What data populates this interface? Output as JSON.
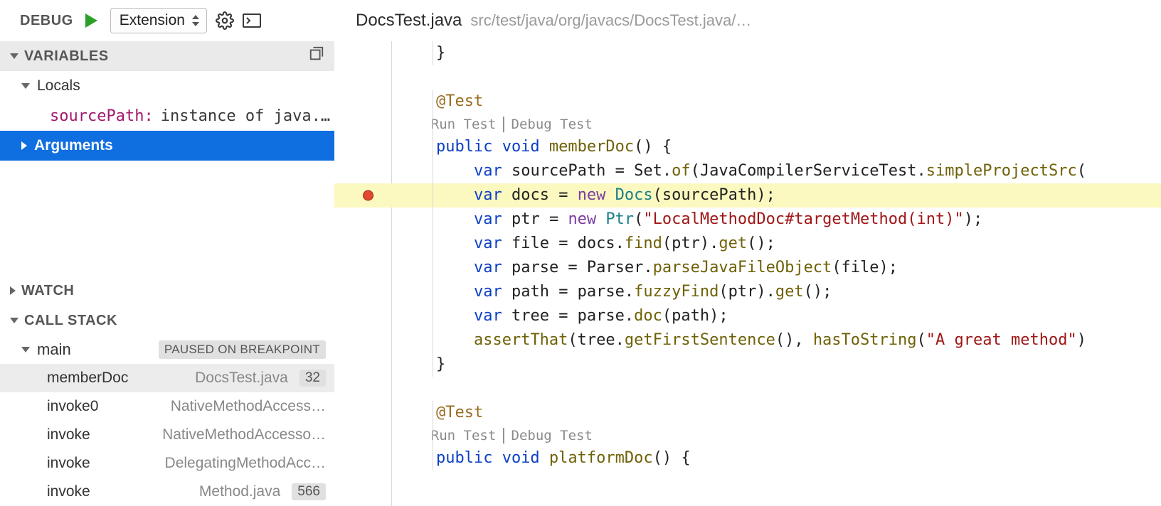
{
  "debug": {
    "label": "DEBUG",
    "config": "Extension"
  },
  "sections": {
    "variables": "VARIABLES",
    "watch": "WATCH",
    "callstack": "CALL STACK"
  },
  "variables": {
    "locals_label": "Locals",
    "sourcePath_key": "sourcePath:",
    "sourcePath_val": "instance of java.u…",
    "arguments_label": "Arguments"
  },
  "callstack": {
    "thread_name": "main",
    "thread_state": "PAUSED ON BREAKPOINT",
    "frames": [
      {
        "fn": "memberDoc",
        "file": "DocsTest.java",
        "line": "32"
      },
      {
        "fn": "invoke0",
        "file": "NativeMethodAccess…",
        "line": ""
      },
      {
        "fn": "invoke",
        "file": "NativeMethodAccesso…",
        "line": ""
      },
      {
        "fn": "invoke",
        "file": "DelegatingMethodAcc…",
        "line": ""
      },
      {
        "fn": "invoke",
        "file": "Method.java",
        "line": "566"
      }
    ]
  },
  "editor": {
    "tab_title": "DocsTest.java",
    "tab_path": "src/test/java/org/javacs/DocsTest.java/…",
    "codelens_run": "Run Test",
    "codelens_debug": "Debug Test"
  },
  "code": {
    "l0": "    }",
    "l1": "",
    "l2a": "    @Test",
    "l3a": "    Run Test | Debug Test",
    "l4_kw1": "    public",
    "l4_kw2": " void",
    "l4_fn": " memberDoc",
    "l4_rest": "() {",
    "l5_pre": "        ",
    "l5_kw": "var",
    "l5_rest1": " sourcePath = Set.",
    "l5_of": "of",
    "l5_rest2": "(JavaCompilerServiceTest.",
    "l5_sp": "simpleProjectSrc",
    "l5_rest3": "(",
    "l6_pre": "        ",
    "l6_kw": "var",
    "l6_rest1": " docs = ",
    "l6_new": "new",
    "l6_type": " Docs",
    "l6_rest2": "(sourcePath);",
    "l7_pre": "        ",
    "l7_kw": "var",
    "l7_rest1": " ptr = ",
    "l7_new": "new",
    "l7_type": " Ptr",
    "l7_rest2": "(",
    "l7_str": "\"LocalMethodDoc#targetMethod(int)\"",
    "l7_rest3": ");",
    "l8_pre": "        ",
    "l8_kw": "var",
    "l8_rest": " file = docs.",
    "l8_fn1": "find",
    "l8_mid": "(ptr).",
    "l8_fn2": "get",
    "l8_end": "();",
    "l9_pre": "        ",
    "l9_kw": "var",
    "l9_rest": " parse = Parser.",
    "l9_fn": "parseJavaFileObject",
    "l9_end": "(file);",
    "l10_pre": "        ",
    "l10_kw": "var",
    "l10_rest": " path = parse.",
    "l10_fn1": "fuzzyFind",
    "l10_mid": "(ptr).",
    "l10_fn2": "get",
    "l10_end": "();",
    "l11_pre": "        ",
    "l11_kw": "var",
    "l11_rest": " tree = parse.",
    "l11_fn": "doc",
    "l11_end": "(path);",
    "l12_pre": "        ",
    "l12_fn": "assertThat",
    "l12_a": "(tree.",
    "l12_gfs": "getFirstSentence",
    "l12_b": "(), ",
    "l12_hts": "hasToString",
    "l12_c": "(",
    "l12_str": "\"A great method\"",
    "l12_d": ")",
    "l13": "    }",
    "l14": "",
    "l15": "    @Test",
    "l16": "    Run Test | Debug Test",
    "l17_kw1": "    public",
    "l17_kw2": " void",
    "l17_fn": " platformDoc",
    "l17_rest": "() {"
  }
}
